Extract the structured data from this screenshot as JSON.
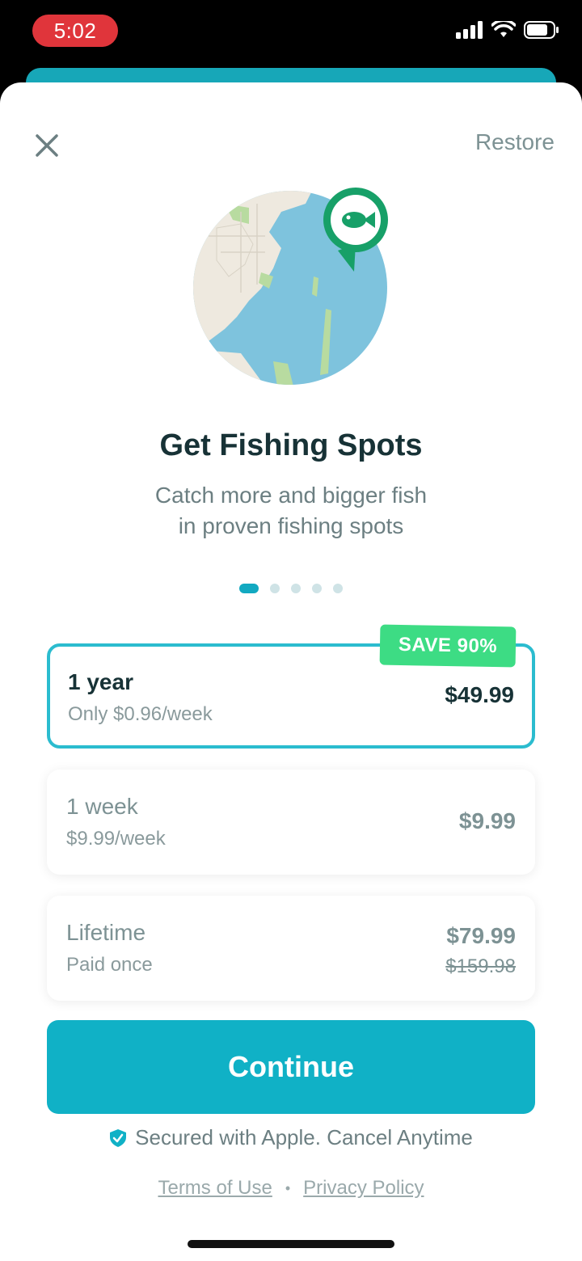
{
  "status_bar": {
    "time": "5:02"
  },
  "header": {
    "restore_label": "Restore"
  },
  "hero": {
    "icon": "fish-map-pin-icon"
  },
  "title": "Get Fishing Spots",
  "subtitle_line1": "Catch more and bigger fish",
  "subtitle_line2": "in proven fishing spots",
  "pager": {
    "total": 5,
    "active": 1
  },
  "plans": [
    {
      "name": "1 year",
      "sub": "Only $0.96/week",
      "price": "$49.99",
      "badge": "SAVE 90%",
      "selected": true
    },
    {
      "name": "1 week",
      "sub": "$9.99/week",
      "price": "$9.99",
      "selected": false
    },
    {
      "name": "Lifetime",
      "sub": "Paid once",
      "price": "$79.99",
      "old_price": "$159.98",
      "selected": false
    }
  ],
  "continue_label": "Continue",
  "secured_text": "Secured with Apple. Cancel Anytime",
  "links": {
    "terms": "Terms of Use",
    "separator": "•",
    "privacy": "Privacy Policy"
  },
  "colors": {
    "accent": "#10b1c6",
    "badge": "#3ddc84",
    "status_time_bg": "#e0353b",
    "title": "#173236"
  }
}
